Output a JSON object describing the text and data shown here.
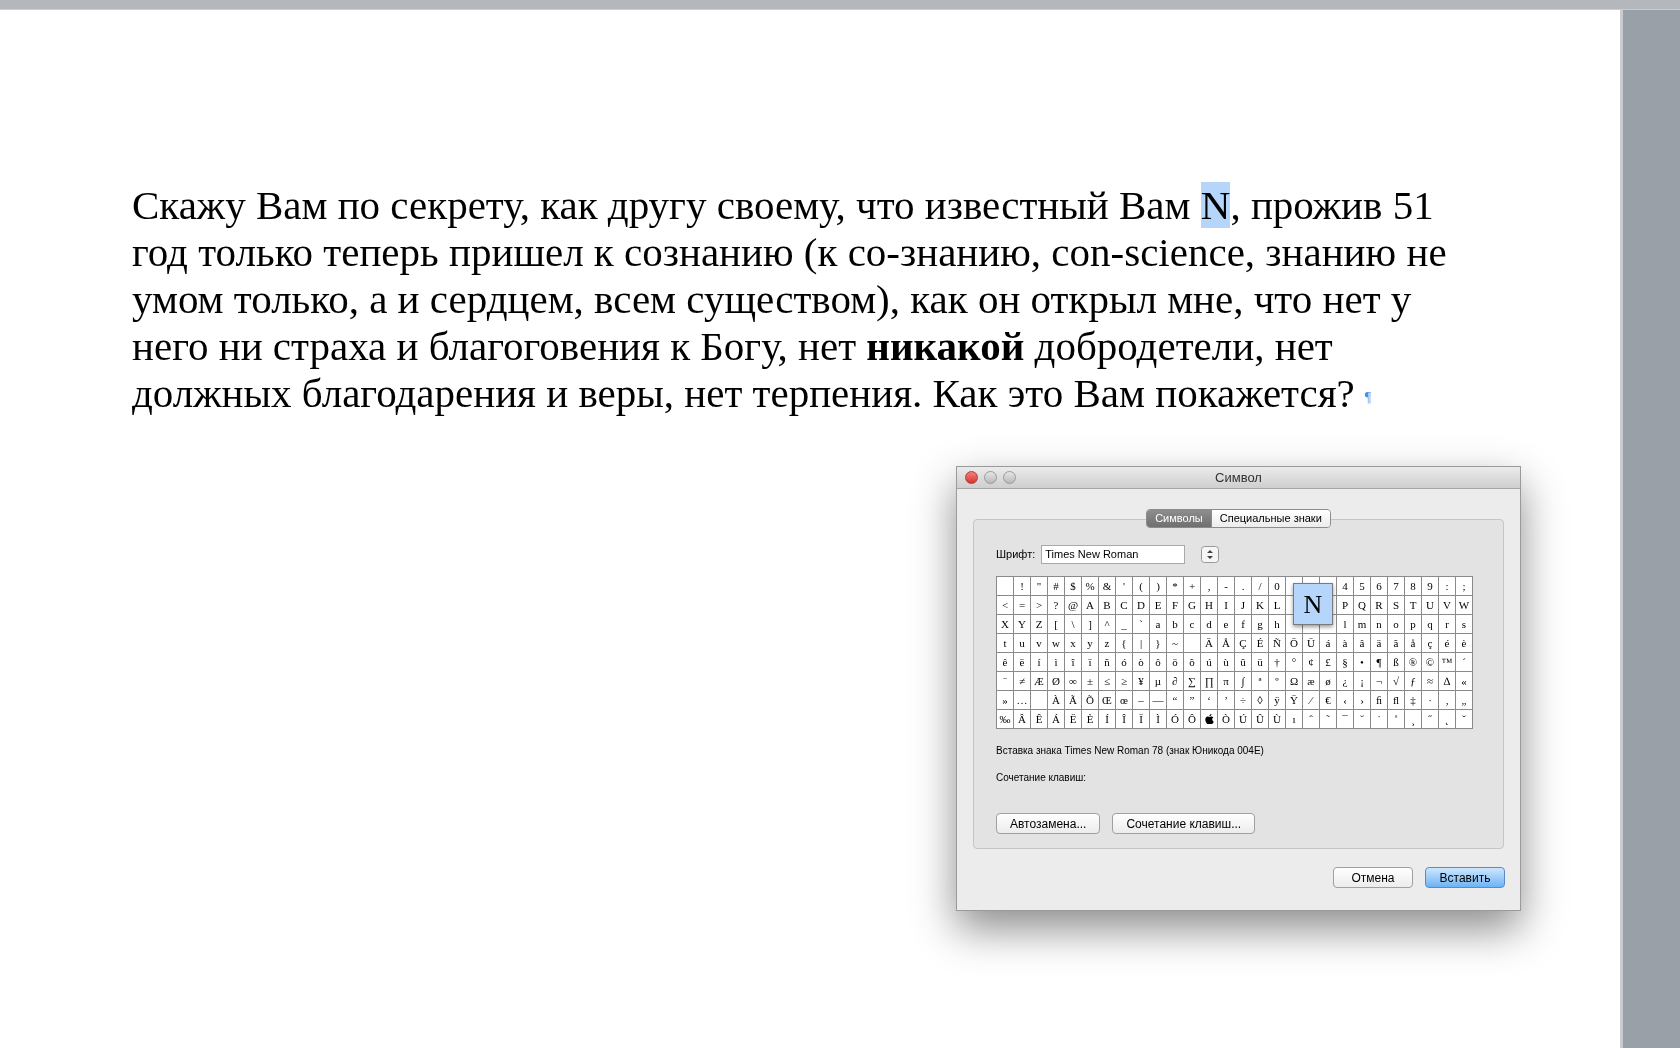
{
  "document": {
    "paragraph": {
      "before": "Скажу Вам по секрету, как другу своему, что известный Вам ",
      "selected": "N",
      "after": ", прожив 51 год только теперь пришел к сознанию (к со-знанию, con-science, знанию не умом только, а и сердцем, всем существом), как он открыл мне, что нет у него ни страха и благоговения к Богу, нет **никакой** добродетели, нет должных благодарения и веры, нет терпения. Как это Вам покажется?",
      "mark": "¶"
    }
  },
  "dialog": {
    "title": "Символ",
    "tabs": [
      {
        "label": "Символы",
        "selected": true
      },
      {
        "label": "Специальные знаки",
        "selected": false
      }
    ],
    "font_label": "Шрифт:",
    "font_value": "Times New Roman",
    "grid": {
      "rows": [
        [
          null,
          "!",
          "\"",
          "#",
          "$",
          "%",
          "&",
          "'",
          "(",
          ")",
          "*",
          "+",
          ",",
          "-",
          ".",
          "/",
          "0",
          null,
          null,
          null,
          "4",
          "5",
          "6",
          "7",
          "8",
          "9",
          ":",
          ";"
        ],
        [
          "<",
          "=",
          ">",
          "?",
          "@",
          "A",
          "B",
          "C",
          "D",
          "E",
          "F",
          "G",
          "H",
          "I",
          "J",
          "K",
          "L",
          null,
          null,
          null,
          "P",
          "Q",
          "R",
          "S",
          "T",
          "U",
          "V",
          "W"
        ],
        [
          "X",
          "Y",
          "Z",
          "[",
          "\\",
          "]",
          "^",
          "_",
          "`",
          "a",
          "b",
          "c",
          "d",
          "e",
          "f",
          "g",
          "h",
          null,
          null,
          null,
          "l",
          "m",
          "n",
          "o",
          "p",
          "q",
          "r",
          "s"
        ],
        [
          "t",
          "u",
          "v",
          "w",
          "x",
          "y",
          "z",
          "{",
          "|",
          "}",
          "~",
          null,
          "Ä",
          "Å",
          "Ç",
          "É",
          "Ñ",
          "Ö",
          "Ü",
          "á",
          "à",
          "â",
          "ä",
          "ã",
          "å",
          "ç",
          "é",
          "è"
        ],
        [
          "ê",
          "ë",
          "í",
          "ì",
          "î",
          "ï",
          "ñ",
          "ó",
          "ò",
          "ô",
          "ö",
          "õ",
          "ú",
          "ù",
          "û",
          "ü",
          "†",
          "°",
          "¢",
          "£",
          "§",
          "•",
          "¶",
          "ß",
          "®",
          "©",
          "™",
          "´"
        ],
        [
          "¨",
          "≠",
          "Æ",
          "Ø",
          "∞",
          "±",
          "≤",
          "≥",
          "¥",
          "µ",
          "∂",
          "∑",
          "∏",
          "π",
          "∫",
          "ª",
          "º",
          "Ω",
          "æ",
          "ø",
          "¿",
          "¡",
          "¬",
          "√",
          "ƒ",
          "≈",
          "∆",
          "«"
        ],
        [
          "»",
          "…",
          null,
          "À",
          "Ã",
          "Õ",
          "Œ",
          "œ",
          "–",
          "—",
          "“",
          "”",
          "‘",
          "’",
          "÷",
          "◊",
          "ÿ",
          "Ÿ",
          "⁄",
          "€",
          "‹",
          "›",
          "ﬁ",
          "ﬂ",
          "‡",
          "·",
          "‚",
          "„"
        ],
        [
          "‰",
          "Â",
          "Ê",
          "Á",
          "Ë",
          "È",
          "Í",
          "Î",
          "Ï",
          "Ì",
          "Ó",
          "Ô",
          {
            "kind": "apple"
          },
          "Ò",
          "Ú",
          "Û",
          "Ù",
          "ı",
          "ˆ",
          "˜",
          "¯",
          "˘",
          "˙",
          "˚",
          "¸",
          "˝",
          "˛",
          "ˇ"
        ]
      ],
      "popup": "N"
    },
    "info": "Вставка знака Times New Roman 78 (знак Юникода 004E)",
    "shortcut_label": "Сочетание клавиш:",
    "buttons": [
      {
        "label": "Автозамена..."
      },
      {
        "label": "Сочетание клавиш..."
      }
    ],
    "footer_buttons": [
      {
        "label": "Отмена",
        "default": false
      },
      {
        "label": "Вставить",
        "default": true
      }
    ]
  }
}
